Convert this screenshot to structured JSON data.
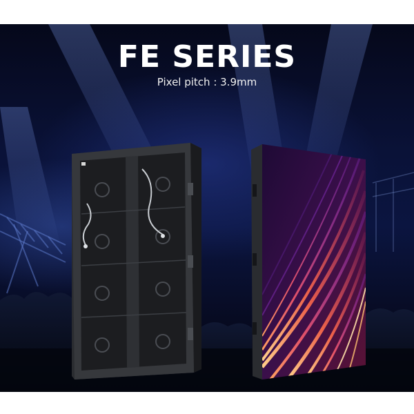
{
  "banner": {
    "title": "FE SERIES",
    "subtitle": "Pixel pitch : 3.9mm"
  },
  "products": [
    {
      "view": "back",
      "description_icon": "led-cabinet-rear-icon"
    },
    {
      "view": "front",
      "description_icon": "led-cabinet-display-icon"
    }
  ],
  "colors": {
    "background_dark": "#070b22",
    "title_text": "#ffffff",
    "display_purple": "#3a0f4a",
    "display_orange": "#ff8a3d"
  }
}
